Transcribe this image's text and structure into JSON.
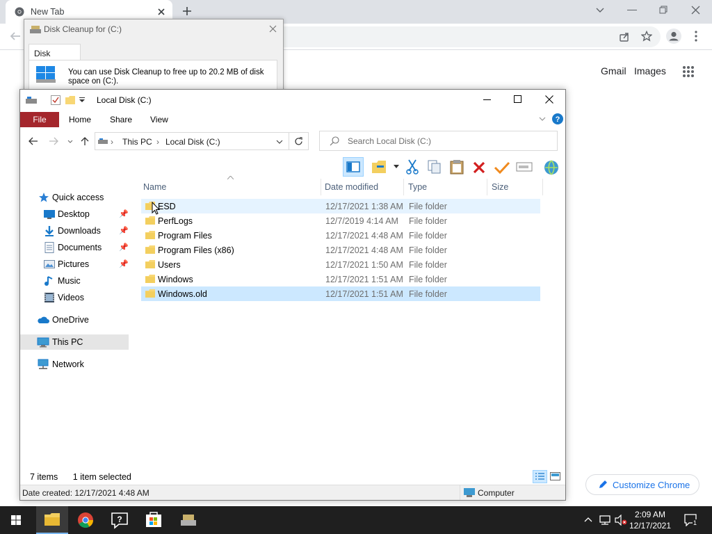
{
  "chrome": {
    "tab_title": "New Tab",
    "links": [
      "Gmail",
      "Images"
    ],
    "customize_label": "Customize Chrome"
  },
  "disk_cleanup": {
    "title": "Disk Cleanup for  (C:)",
    "tab_label": "Disk Cleanup",
    "message": "You can use Disk Cleanup to free up to 20.2 MB of disk space on  (C:)."
  },
  "explorer": {
    "title": "Local Disk (C:)",
    "ribbon_tabs": [
      "File",
      "Home",
      "Share",
      "View"
    ],
    "breadcrumb": [
      "This PC",
      "Local Disk (C:)"
    ],
    "search_placeholder": "Search Local Disk (C:)",
    "columns": [
      "Name",
      "Date modified",
      "Type",
      "Size"
    ],
    "nav": {
      "quick_access": "Quick access",
      "desktop": "Desktop",
      "downloads": "Downloads",
      "documents": "Documents",
      "pictures": "Pictures",
      "music": "Music",
      "videos": "Videos",
      "onedrive": "OneDrive",
      "thispc": "This PC",
      "network": "Network"
    },
    "files": [
      {
        "name": "ESD",
        "date": "12/17/2021 1:38 AM",
        "type": "File folder"
      },
      {
        "name": "PerfLogs",
        "date": "12/7/2019 4:14 AM",
        "type": "File folder"
      },
      {
        "name": "Program Files",
        "date": "12/17/2021 4:48 AM",
        "type": "File folder"
      },
      {
        "name": "Program Files (x86)",
        "date": "12/17/2021 4:48 AM",
        "type": "File folder"
      },
      {
        "name": "Users",
        "date": "12/17/2021 1:50 AM",
        "type": "File folder"
      },
      {
        "name": "Windows",
        "date": "12/17/2021 1:51 AM",
        "type": "File folder"
      },
      {
        "name": "Windows.old",
        "date": "12/17/2021 1:51 AM",
        "type": "File folder"
      }
    ],
    "item_count": "7 items",
    "selection": "1 item selected",
    "details_left": "Date created: 12/17/2021 4:48 AM",
    "details_right": "Computer"
  },
  "taskbar": {
    "time": "2:09 AM",
    "date": "12/17/2021",
    "notification_count": "1"
  },
  "colors": {
    "file_tab": "#a4262c",
    "selection": "#cce8ff",
    "hover": "#e5f3ff",
    "taskbar": "#1f1f1f"
  }
}
